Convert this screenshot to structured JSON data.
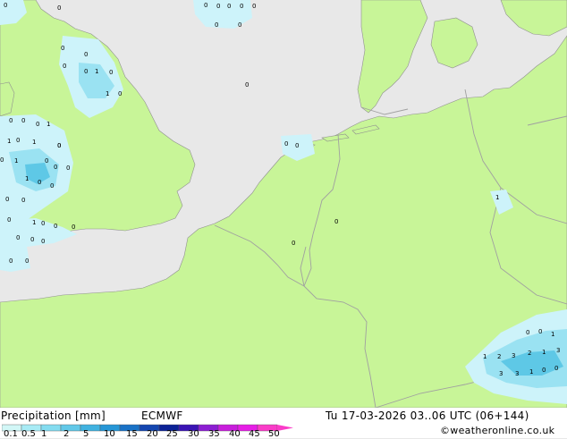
{
  "footer": {
    "title": "Precipitation [mm]",
    "model": "ECMWF",
    "valid_time": "Tu 17-03-2026 03..06 UTC (06+144)",
    "copyright": "©weatheronline.co.uk"
  },
  "legend": {
    "ticks": [
      "0.1",
      "0.5",
      "1",
      "2",
      "5",
      "10",
      "15",
      "20",
      "25",
      "30",
      "35",
      "40",
      "45",
      "50"
    ],
    "colors": [
      "#d2f7f7",
      "#a8ebf5",
      "#84dcf0",
      "#62c8e8",
      "#41b2e0",
      "#2696d6",
      "#1a72c6",
      "#1446b0",
      "#0c2296",
      "#3a14b4",
      "#8c1ed2",
      "#c81edc",
      "#e61ee6",
      "#fa3cc8"
    ]
  },
  "colors": {
    "land": "#c8f598",
    "sea": "#e8e8e8",
    "border": "#a0a0a0",
    "coast": "#909090",
    "precip_light": "#cdf3fa",
    "precip_medium": "#9ae2f2",
    "precip_heavy": "#5ec8e6"
  },
  "map_labels": [
    {
      "text": "0"
    },
    {
      "text": "0"
    },
    {
      "text": "0"
    },
    {
      "text": "0"
    },
    {
      "text": "0"
    },
    {
      "text": "0"
    },
    {
      "text": "0"
    },
    {
      "text": "0"
    },
    {
      "text": "0"
    },
    {
      "text": "0"
    },
    {
      "text": "0"
    },
    {
      "text": "1"
    },
    {
      "text": "1"
    },
    {
      "text": "0"
    },
    {
      "text": "0"
    },
    {
      "text": "0"
    },
    {
      "text": "0"
    },
    {
      "text": "0"
    },
    {
      "text": "0"
    },
    {
      "text": "0"
    },
    {
      "text": "0"
    },
    {
      "text": "1"
    },
    {
      "text": "0"
    },
    {
      "text": "0"
    },
    {
      "text": "1"
    },
    {
      "text": "0"
    },
    {
      "text": "0"
    },
    {
      "text": "0"
    },
    {
      "text": "1"
    },
    {
      "text": "0"
    },
    {
      "text": "1"
    },
    {
      "text": "1"
    },
    {
      "text": "0"
    },
    {
      "text": "0"
    },
    {
      "text": "0"
    },
    {
      "text": "0"
    },
    {
      "text": "0"
    },
    {
      "text": "1"
    },
    {
      "text": "0"
    },
    {
      "text": "0"
    },
    {
      "text": "0"
    },
    {
      "text": "0"
    },
    {
      "text": "0"
    },
    {
      "text": "0"
    },
    {
      "text": "0"
    },
    {
      "text": "0"
    },
    {
      "text": "0"
    },
    {
      "text": "0"
    },
    {
      "text": "0"
    },
    {
      "text": "0"
    },
    {
      "text": "0"
    },
    {
      "text": "1"
    },
    {
      "text": "0"
    },
    {
      "text": "0"
    },
    {
      "text": "1"
    },
    {
      "text": "1"
    },
    {
      "text": "2"
    },
    {
      "text": "3"
    },
    {
      "text": "2"
    },
    {
      "text": "1"
    },
    {
      "text": "3"
    },
    {
      "text": "3"
    },
    {
      "text": "3"
    },
    {
      "text": "1"
    },
    {
      "text": "0"
    },
    {
      "text": "0"
    }
  ]
}
